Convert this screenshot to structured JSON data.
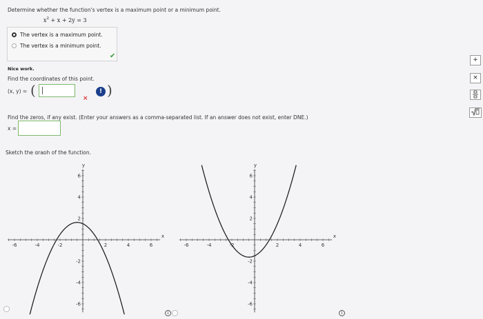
{
  "question": {
    "prompt": "Determine whether the function's vertex is a maximum point or a minimum point.",
    "equation_base": "x",
    "equation_exp": "2",
    "equation_rest": " + x + 2y = 3"
  },
  "choices": [
    {
      "label": "The vertex is a maximum point.",
      "selected": true
    },
    {
      "label": "The vertex is a minimum point.",
      "selected": false
    }
  ],
  "feedback": {
    "nice_work": "Nice work.",
    "coords_prompt": "Find the coordinates of this point.",
    "coords_label": "(x, y) =",
    "coords_value": "",
    "error_icon_text": "!",
    "wrong_mark": "×"
  },
  "zeros": {
    "prompt": "Find the zeros, if any exist. (Enter your answers as a comma-separated list. If an answer does not exist, enter DNE.)",
    "label": "x =",
    "value": ""
  },
  "sketch": {
    "prompt": "Sketch the graph of the function."
  },
  "graphs": [
    {
      "name": "downward-parabola",
      "xlabel": "x",
      "ylabel": "y",
      "x_ticks": [
        "-6",
        "-4",
        "-2",
        "2",
        "4",
        "6"
      ],
      "y_ticks": [
        "6",
        "4",
        "2",
        "-2",
        "-4",
        "-6"
      ],
      "xlim": [
        -7,
        7
      ],
      "ylim": [
        -7,
        7
      ],
      "curve": "y = -(x^2 + x - 3)/2"
    },
    {
      "name": "upward-parabola",
      "xlabel": "x",
      "ylabel": "y",
      "x_ticks": [
        "-6",
        "-4",
        "-2",
        "2",
        "4",
        "6"
      ],
      "y_ticks": [
        "6",
        "4",
        "2",
        "-2",
        "-4",
        "-6"
      ],
      "xlim": [
        -7,
        7
      ],
      "ylim": [
        -7,
        7
      ],
      "curve": "y = (x^2 + x - 3)/2"
    }
  ],
  "toolbar": {
    "plus": "+",
    "times": "×",
    "fraction": "▯",
    "sqrt": "√▯"
  },
  "info_icon_text": "i",
  "colors": {
    "selected_border": "#7db96b",
    "check_green": "#3a9b3a",
    "error_blue": "#1a3f8c",
    "wrong_red": "#d33333"
  }
}
